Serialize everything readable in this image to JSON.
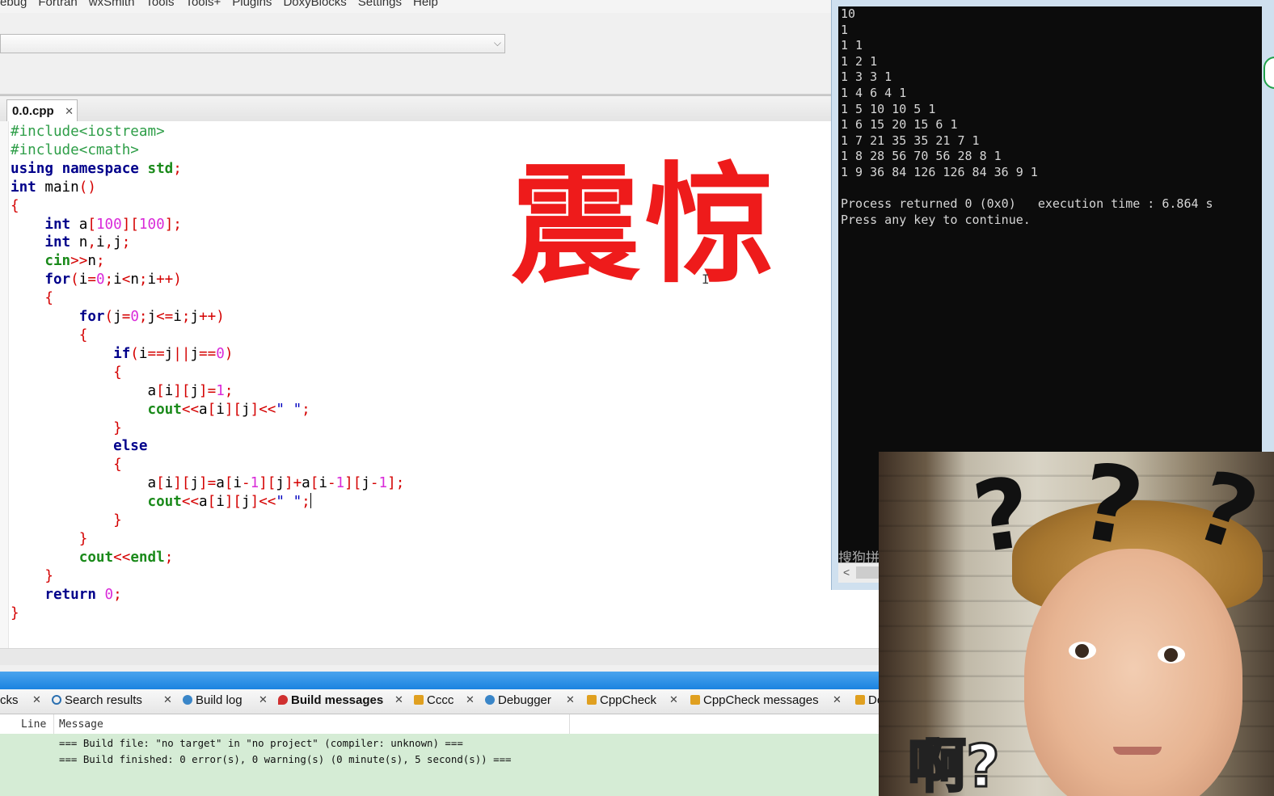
{
  "menu": [
    "ebug",
    "Fortran",
    "wxSmith",
    "Tools",
    "Tools+",
    "Plugins",
    "DoxyBlocks",
    "Settings",
    "Help"
  ],
  "editor_tab": {
    "label": "0.0.cpp",
    "close": "✕"
  },
  "combo_arrow": "⌵",
  "overlay_text": "震惊",
  "mouse_cursor": "I",
  "log_tabs": [
    {
      "label": "cks",
      "icon": "",
      "color": ""
    },
    {
      "label": "Search results",
      "icon": "search-icon",
      "color": "#2a6fb0"
    },
    {
      "label": "Build log",
      "icon": "gear-icon",
      "color": "#3a86c8"
    },
    {
      "label": "Build messages",
      "icon": "pin-icon",
      "color": "#d03030",
      "active": true
    },
    {
      "label": "Cccc",
      "icon": "document-icon",
      "color": "#e0a020"
    },
    {
      "label": "Debugger",
      "icon": "gear-icon",
      "color": "#3a86c8"
    },
    {
      "label": "CppCheck",
      "icon": "document-icon",
      "color": "#e0a020"
    },
    {
      "label": "CppCheck messages",
      "icon": "document-icon",
      "color": "#e0a020"
    },
    {
      "label": "Do",
      "icon": "document-icon",
      "color": "#e0a020"
    }
  ],
  "log_columns": {
    "line": "Line",
    "message": "Message"
  },
  "log_messages": [
    "=== Build file: \"no target\" in \"no project\" (compiler: unknown) ===",
    "=== Build finished: 0 error(s), 0 warning(s) (0 minute(s), 5 second(s)) ==="
  ],
  "console": {
    "lines": [
      "10",
      "1",
      "1 1",
      "1 2 1",
      "1 3 3 1",
      "1 4 6 4 1",
      "1 5 10 10 5 1",
      "1 6 15 20 15 6 1",
      "1 7 21 35 35 21 7 1",
      "1 8 28 56 70 56 28 8 1",
      "1 9 36 84 126 126 84 36 9 1",
      "",
      "Process returned 0 (0x0)   execution time : 6.864 s",
      "Press any key to continue."
    ],
    "ime_text": "搜狗拼",
    "scroll_left": "<"
  },
  "meme": {
    "caption": "啊?",
    "question_mark": "?"
  }
}
